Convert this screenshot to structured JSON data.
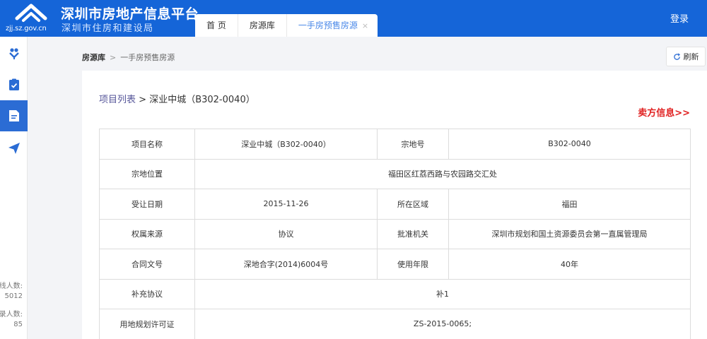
{
  "header": {
    "logo_domain": "zjj.sz.gov.cn",
    "title": "深圳市房地产信息平台",
    "subtitle": "深圳市住房和建设局",
    "tabs": [
      {
        "label": "首 页"
      },
      {
        "label": "房源库"
      },
      {
        "label": "一手房预售房源",
        "close": "×"
      }
    ],
    "login": "登录"
  },
  "sidebar": {
    "stats": [
      {
        "label": "线人数:",
        "value": "5012"
      },
      {
        "label": "录人数:",
        "value": "85"
      }
    ]
  },
  "breadcrumb": {
    "root": "房源库",
    "separator": ">",
    "current": "一手房预售房源"
  },
  "toolbar": {
    "refresh": "刷新"
  },
  "project": {
    "list_link": "项目列表",
    "arrow": ">",
    "name": "深业中城（B302-0040）",
    "seller_link": "卖方信息>>"
  },
  "info": {
    "project_name_label": "项目名称",
    "project_name": "深业中城（B302-0040）",
    "parcel_no_label": "宗地号",
    "parcel_no": "B302-0040",
    "location_label": "宗地位置",
    "location": "福田区红荔西路与农园路交汇处",
    "transfer_date_label": "受让日期",
    "transfer_date": "2015-11-26",
    "district_label": "所在区域",
    "district": "福田",
    "ownership_label": "权属来源",
    "ownership": "协议",
    "approval_label": "批准机关",
    "approval": "深圳市规划和国土资源委员会第一直属管理局",
    "contract_label": "合同文号",
    "contract": "深地合字(2014)6004号",
    "term_label": "使用年限",
    "term": "40年",
    "supplement_label": "补充协议",
    "supplement": "补1",
    "permit_label": "用地规划许可证",
    "permit": "ZS-2015-0065;"
  }
}
